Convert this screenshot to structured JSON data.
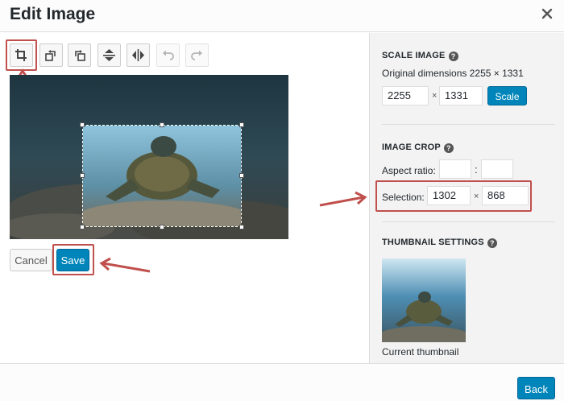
{
  "dialog": {
    "title": "Edit Image"
  },
  "toolbar": {
    "icons": [
      "crop-icon",
      "rotate-left-icon",
      "rotate-right-icon",
      "flip-vertical-icon",
      "flip-horizontal-icon",
      "undo-icon",
      "redo-icon"
    ]
  },
  "actions": {
    "cancel_label": "Cancel",
    "save_label": "Save"
  },
  "scale": {
    "title": "SCALE IMAGE",
    "original": "Original dimensions 2255 × 1331",
    "width": "2255",
    "height": "1331",
    "times": "×",
    "button_label": "Scale"
  },
  "crop": {
    "title": "IMAGE CROP",
    "aspect_label": "Aspect ratio:",
    "aspect_w": "",
    "aspect_h": "",
    "colon": ":",
    "selection_label": "Selection:",
    "sel_w": "1302",
    "sel_h": "868",
    "times": "×"
  },
  "thumbnail": {
    "title": "THUMBNAIL SETTINGS",
    "caption": "Current thumbnail"
  },
  "footer": {
    "back_label": "Back"
  },
  "help_glyph": "?",
  "colors": {
    "accent": "#0085ba",
    "annotation": "#c0504d",
    "panel": "#f3f3f3"
  }
}
